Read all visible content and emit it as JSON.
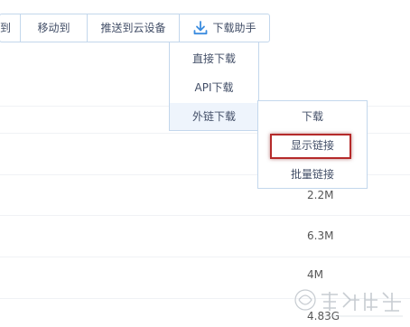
{
  "toolbar": {
    "partial_label": "到",
    "move_label": "移动到",
    "push_label": "推送到云设备",
    "download_helper_label": "下载助手"
  },
  "menu_download_helper": {
    "items": [
      {
        "label": "直接下载"
      },
      {
        "label": "API下载"
      },
      {
        "label": "外链下载"
      }
    ]
  },
  "menu_external": {
    "items": [
      {
        "label": "下载"
      },
      {
        "label": "显示链接"
      },
      {
        "label": "批量链接"
      }
    ]
  },
  "file_sizes": [
    "2.2M",
    "6.3M",
    "4M",
    "4.83G"
  ],
  "colors": {
    "accent": "#3b8cdf",
    "border": "#c3d7ec",
    "highlight": "#b52a2a"
  },
  "icons": {
    "download": "download-icon"
  }
}
